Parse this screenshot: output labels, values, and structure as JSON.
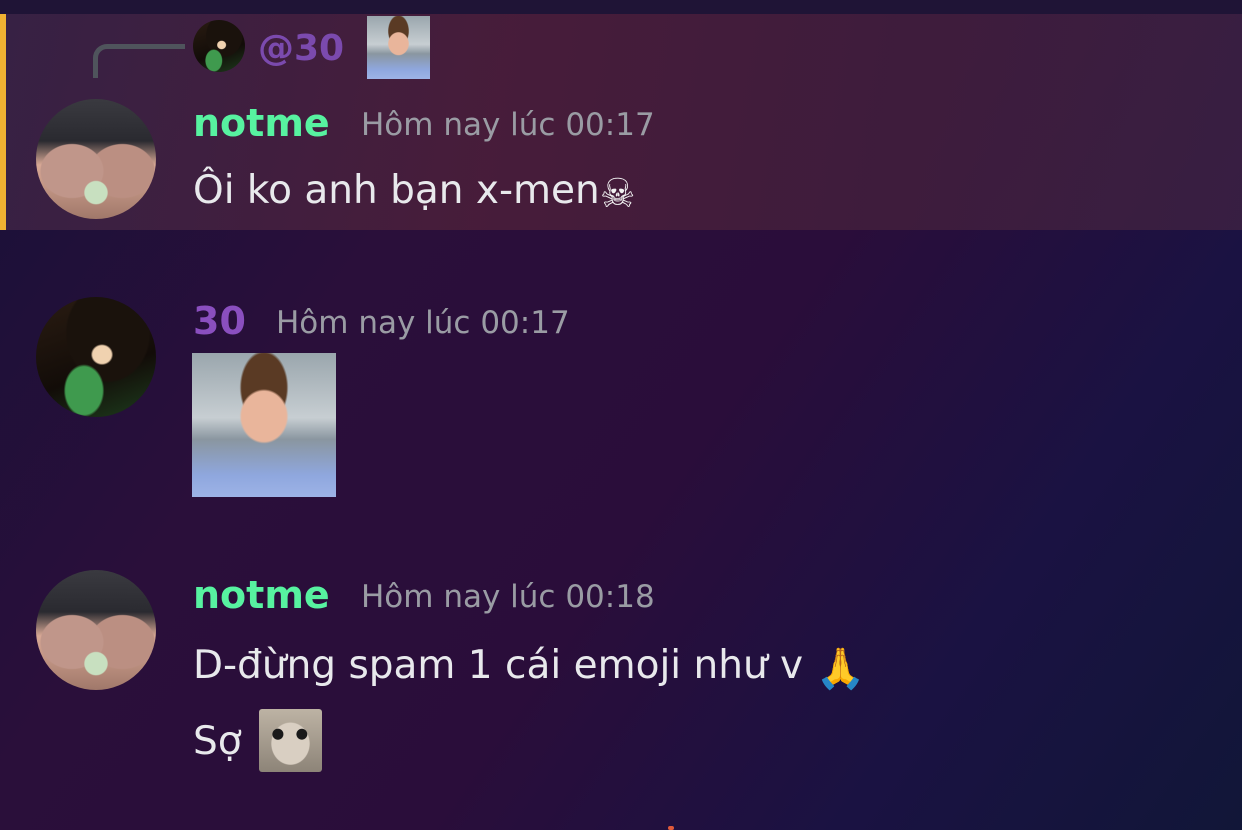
{
  "reply": {
    "mention": "@30",
    "author_avatar_icon": "avatar-30-icon",
    "attachment": "reply-image-thumbnail"
  },
  "messages": [
    {
      "username": "notme",
      "timestamp": "Hôm nay lúc 00:17",
      "text": "Ôi ko anh bạn x-men",
      "emoji": "☠",
      "highlighted": true,
      "username_color": "#57f2a0"
    },
    {
      "username": "30",
      "timestamp": "Hôm nay lúc 00:17",
      "attachment": "image",
      "username_color": "#8a4fbf"
    },
    {
      "username": "notme",
      "timestamp": "Hôm nay lúc 00:18",
      "text": "D-đừng spam 1 cái emoji như v",
      "emoji": "🙏",
      "username_color": "#57f2a0"
    },
    {
      "text": "Sợ",
      "emoji_image": "hamster-emoji"
    }
  ],
  "colors": {
    "mention_bar": "#f0b232",
    "timestamp": "#9a9ca4"
  }
}
